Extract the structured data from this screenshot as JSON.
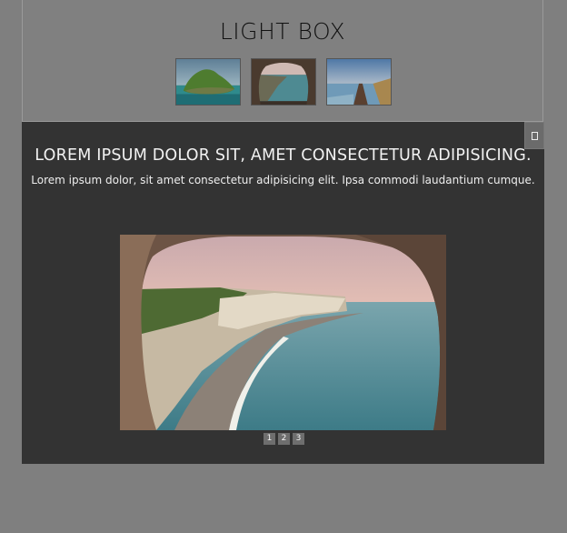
{
  "header": {
    "title": "LIGHT BOX"
  },
  "thumbnails": [
    {
      "name": "island-thumbnail"
    },
    {
      "name": "cliff-cave-thumbnail"
    },
    {
      "name": "pier-lake-thumbnail"
    }
  ],
  "lightbox": {
    "heading": "LOREM IPSUM DOLOR SIT, AMET CONSECTETUR ADIPISICING.",
    "description": "Lorem ipsum dolor, sit amet consectetur adipisicing elit. Ipsa commodi laudantium cumque.",
    "close_icon": "close-icon",
    "pager": [
      "1",
      "2",
      "3"
    ],
    "selected_page": "2"
  }
}
